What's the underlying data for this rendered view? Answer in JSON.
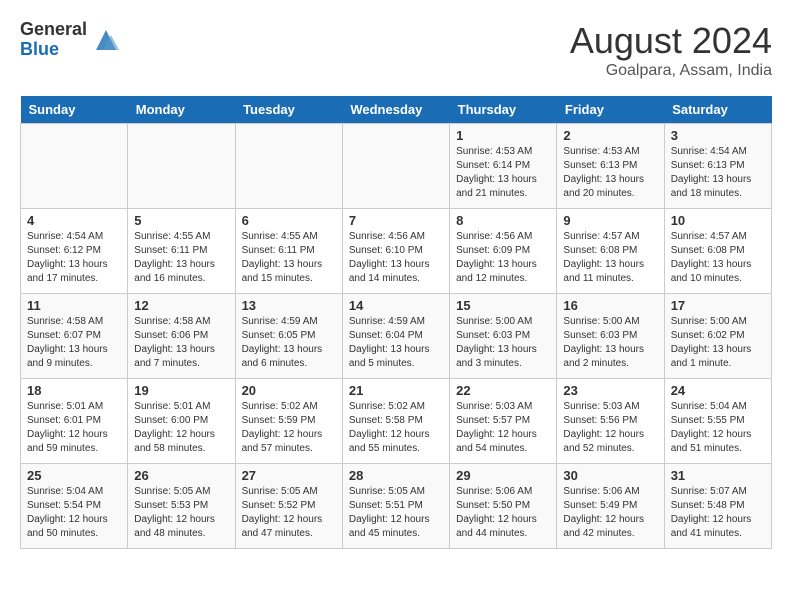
{
  "header": {
    "logo_general": "General",
    "logo_blue": "Blue",
    "month_year": "August 2024",
    "location": "Goalpara, Assam, India"
  },
  "weekdays": [
    "Sunday",
    "Monday",
    "Tuesday",
    "Wednesday",
    "Thursday",
    "Friday",
    "Saturday"
  ],
  "weeks": [
    [
      {
        "day": "",
        "info": ""
      },
      {
        "day": "",
        "info": ""
      },
      {
        "day": "",
        "info": ""
      },
      {
        "day": "",
        "info": ""
      },
      {
        "day": "1",
        "info": "Sunrise: 4:53 AM\nSunset: 6:14 PM\nDaylight: 13 hours\nand 21 minutes."
      },
      {
        "day": "2",
        "info": "Sunrise: 4:53 AM\nSunset: 6:13 PM\nDaylight: 13 hours\nand 20 minutes."
      },
      {
        "day": "3",
        "info": "Sunrise: 4:54 AM\nSunset: 6:13 PM\nDaylight: 13 hours\nand 18 minutes."
      }
    ],
    [
      {
        "day": "4",
        "info": "Sunrise: 4:54 AM\nSunset: 6:12 PM\nDaylight: 13 hours\nand 17 minutes."
      },
      {
        "day": "5",
        "info": "Sunrise: 4:55 AM\nSunset: 6:11 PM\nDaylight: 13 hours\nand 16 minutes."
      },
      {
        "day": "6",
        "info": "Sunrise: 4:55 AM\nSunset: 6:11 PM\nDaylight: 13 hours\nand 15 minutes."
      },
      {
        "day": "7",
        "info": "Sunrise: 4:56 AM\nSunset: 6:10 PM\nDaylight: 13 hours\nand 14 minutes."
      },
      {
        "day": "8",
        "info": "Sunrise: 4:56 AM\nSunset: 6:09 PM\nDaylight: 13 hours\nand 12 minutes."
      },
      {
        "day": "9",
        "info": "Sunrise: 4:57 AM\nSunset: 6:08 PM\nDaylight: 13 hours\nand 11 minutes."
      },
      {
        "day": "10",
        "info": "Sunrise: 4:57 AM\nSunset: 6:08 PM\nDaylight: 13 hours\nand 10 minutes."
      }
    ],
    [
      {
        "day": "11",
        "info": "Sunrise: 4:58 AM\nSunset: 6:07 PM\nDaylight: 13 hours\nand 9 minutes."
      },
      {
        "day": "12",
        "info": "Sunrise: 4:58 AM\nSunset: 6:06 PM\nDaylight: 13 hours\nand 7 minutes."
      },
      {
        "day": "13",
        "info": "Sunrise: 4:59 AM\nSunset: 6:05 PM\nDaylight: 13 hours\nand 6 minutes."
      },
      {
        "day": "14",
        "info": "Sunrise: 4:59 AM\nSunset: 6:04 PM\nDaylight: 13 hours\nand 5 minutes."
      },
      {
        "day": "15",
        "info": "Sunrise: 5:00 AM\nSunset: 6:03 PM\nDaylight: 13 hours\nand 3 minutes."
      },
      {
        "day": "16",
        "info": "Sunrise: 5:00 AM\nSunset: 6:03 PM\nDaylight: 13 hours\nand 2 minutes."
      },
      {
        "day": "17",
        "info": "Sunrise: 5:00 AM\nSunset: 6:02 PM\nDaylight: 13 hours\nand 1 minute."
      }
    ],
    [
      {
        "day": "18",
        "info": "Sunrise: 5:01 AM\nSunset: 6:01 PM\nDaylight: 12 hours\nand 59 minutes."
      },
      {
        "day": "19",
        "info": "Sunrise: 5:01 AM\nSunset: 6:00 PM\nDaylight: 12 hours\nand 58 minutes."
      },
      {
        "day": "20",
        "info": "Sunrise: 5:02 AM\nSunset: 5:59 PM\nDaylight: 12 hours\nand 57 minutes."
      },
      {
        "day": "21",
        "info": "Sunrise: 5:02 AM\nSunset: 5:58 PM\nDaylight: 12 hours\nand 55 minutes."
      },
      {
        "day": "22",
        "info": "Sunrise: 5:03 AM\nSunset: 5:57 PM\nDaylight: 12 hours\nand 54 minutes."
      },
      {
        "day": "23",
        "info": "Sunrise: 5:03 AM\nSunset: 5:56 PM\nDaylight: 12 hours\nand 52 minutes."
      },
      {
        "day": "24",
        "info": "Sunrise: 5:04 AM\nSunset: 5:55 PM\nDaylight: 12 hours\nand 51 minutes."
      }
    ],
    [
      {
        "day": "25",
        "info": "Sunrise: 5:04 AM\nSunset: 5:54 PM\nDaylight: 12 hours\nand 50 minutes."
      },
      {
        "day": "26",
        "info": "Sunrise: 5:05 AM\nSunset: 5:53 PM\nDaylight: 12 hours\nand 48 minutes."
      },
      {
        "day": "27",
        "info": "Sunrise: 5:05 AM\nSunset: 5:52 PM\nDaylight: 12 hours\nand 47 minutes."
      },
      {
        "day": "28",
        "info": "Sunrise: 5:05 AM\nSunset: 5:51 PM\nDaylight: 12 hours\nand 45 minutes."
      },
      {
        "day": "29",
        "info": "Sunrise: 5:06 AM\nSunset: 5:50 PM\nDaylight: 12 hours\nand 44 minutes."
      },
      {
        "day": "30",
        "info": "Sunrise: 5:06 AM\nSunset: 5:49 PM\nDaylight: 12 hours\nand 42 minutes."
      },
      {
        "day": "31",
        "info": "Sunrise: 5:07 AM\nSunset: 5:48 PM\nDaylight: 12 hours\nand 41 minutes."
      }
    ]
  ]
}
